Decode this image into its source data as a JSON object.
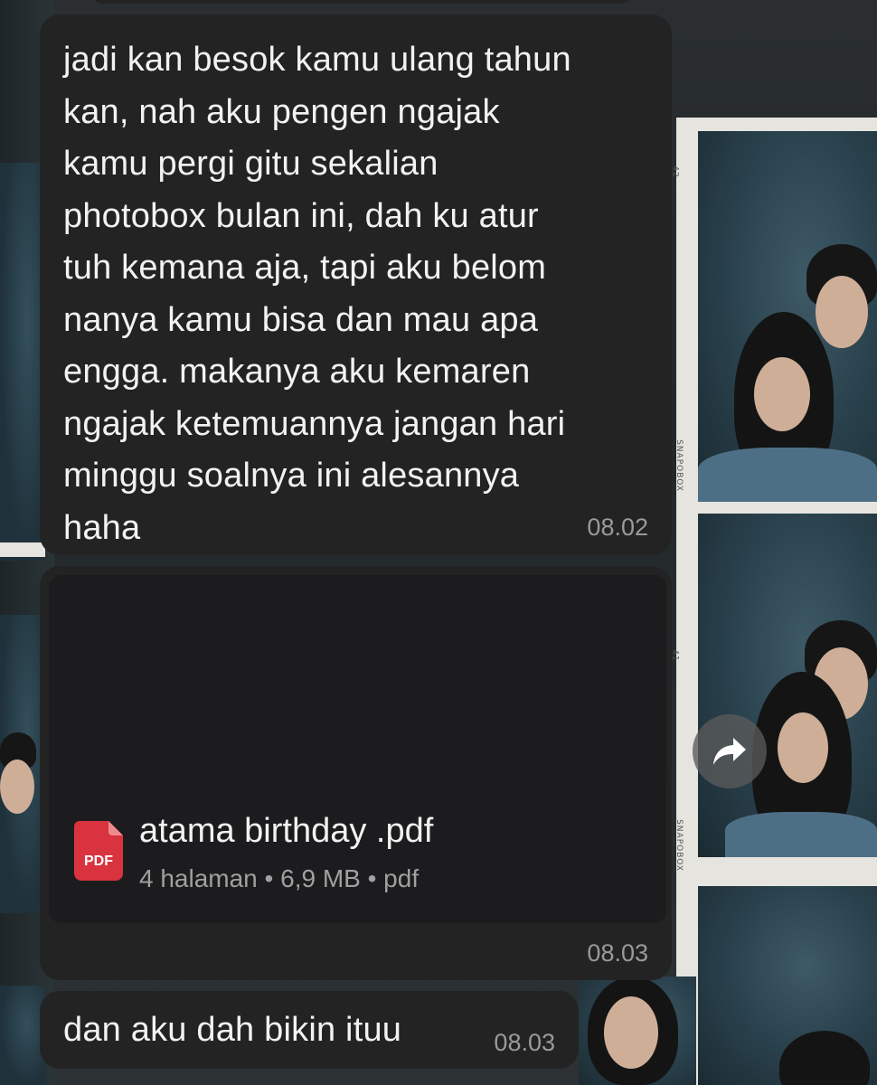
{
  "messages": [
    {
      "type": "text",
      "text": "jadi kan besok kamu ulang tahun\nkan, nah aku pengen ngajak\nkamu pergi gitu sekalian\nphotobox bulan ini, dah ku atur\ntuh kemana aja, tapi aku belom\nnanya kamu bisa dan mau apa\nengga. makanya aku kemaren\nngajak ketemuannya jangan hari\nminggu soalnya ini alesannya\nhaha",
      "time": "08.02"
    },
    {
      "type": "file",
      "file_name": "atama birthday .pdf",
      "file_meta": "4 halaman • 6,9 MB • pdf",
      "icon_label": "PDF",
      "icon": "pdf-file-icon",
      "time": "08.03"
    },
    {
      "type": "text",
      "text": "dan aku dah bikin ituu",
      "time": "08.03"
    }
  ],
  "forward_icon": "forward-arrow-icon",
  "background": {
    "strip_marks": [
      "42",
      "SNAPOBOX",
      "41",
      "SNAPOBOX"
    ]
  },
  "colors": {
    "bubble": "#232323",
    "pdf_red": "#d9333f",
    "time_text": "#9a9a9a"
  }
}
